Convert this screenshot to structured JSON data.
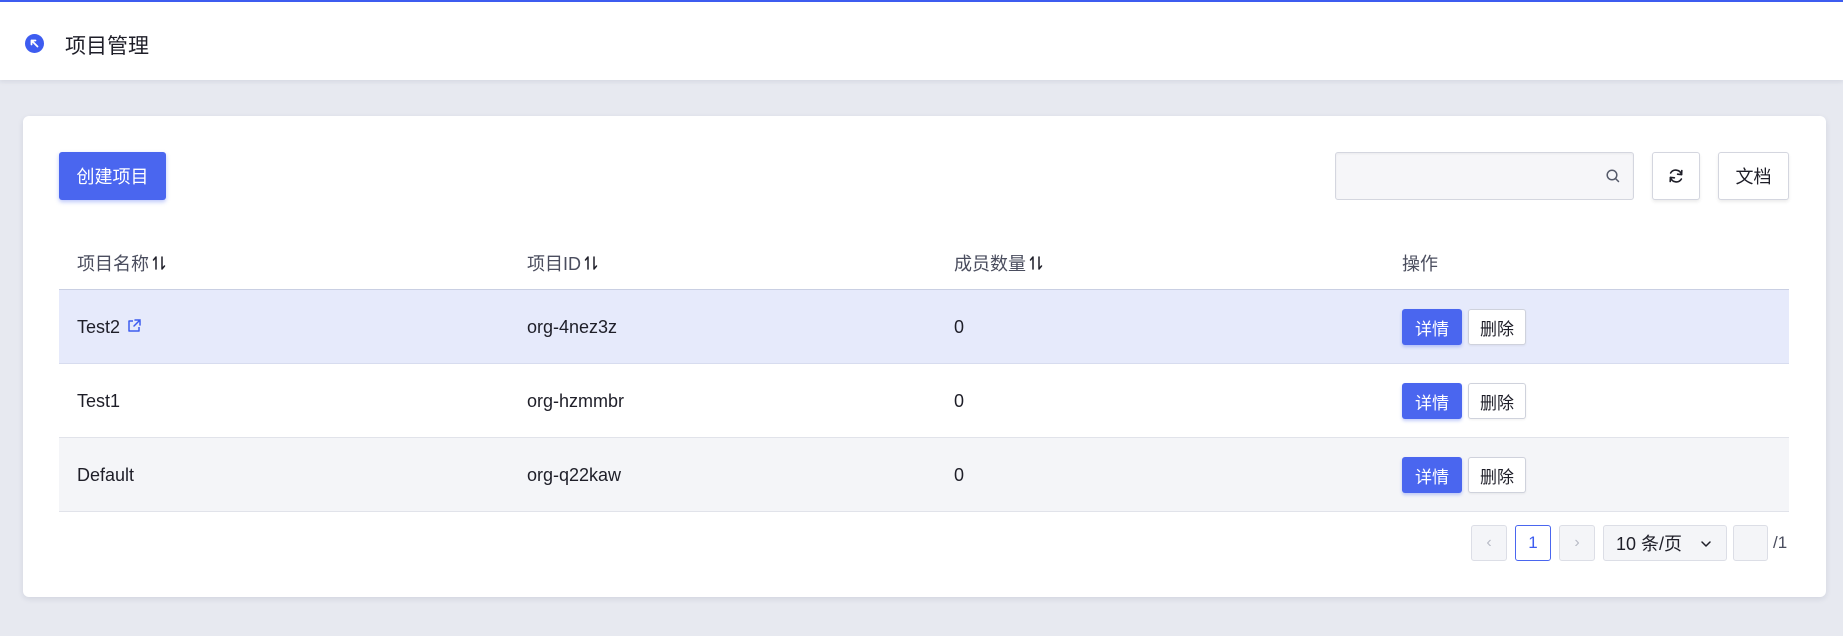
{
  "header": {
    "title": "项目管理"
  },
  "toolbar": {
    "create_label": "创建项目",
    "search_placeholder": "",
    "doc_label": "文档"
  },
  "table": {
    "columns": [
      "项目名称",
      "项目ID",
      "成员数量",
      "操作"
    ],
    "rows": [
      {
        "name": "Test2",
        "id": "org-4nez3z",
        "members": "0",
        "detail": "详情",
        "delete": "删除"
      },
      {
        "name": "Test1",
        "id": "org-hzmmbr",
        "members": "0",
        "detail": "详情",
        "delete": "删除"
      },
      {
        "name": "Default",
        "id": "org-q22kaw",
        "members": "0",
        "detail": "详情",
        "delete": "删除"
      }
    ]
  },
  "pagination": {
    "prev": "‹",
    "current": "1",
    "next": "›",
    "page_size": "10 条/页",
    "jump_value": "",
    "total": "/1"
  },
  "colors": {
    "accent": "#4a66ef",
    "selected_row": "#e6eafb",
    "background": "#e7e9f0"
  }
}
